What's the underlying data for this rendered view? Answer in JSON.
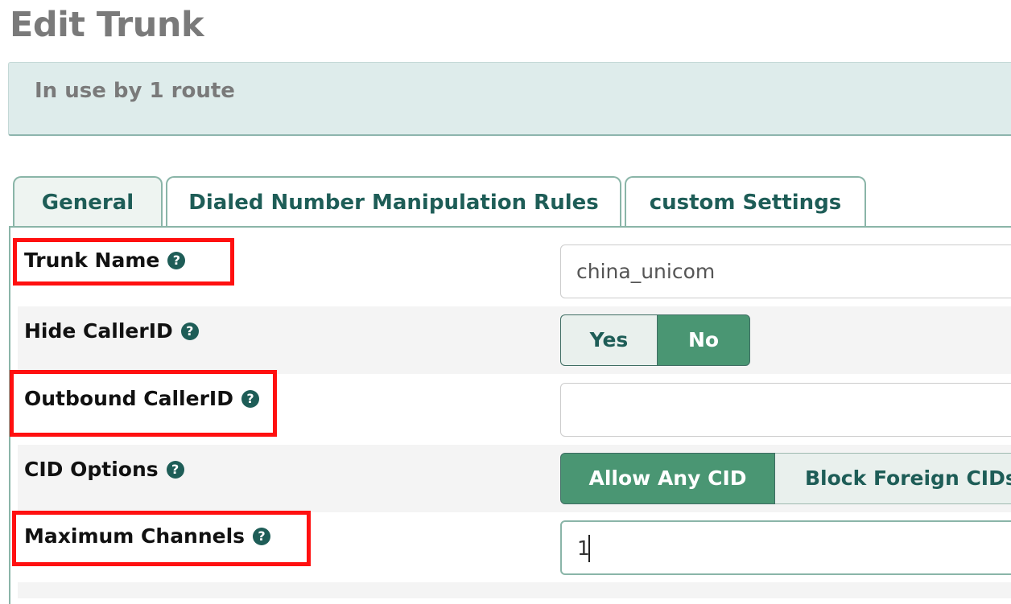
{
  "page": {
    "title": "Edit Trunk"
  },
  "info_panel": {
    "text": "In use by 1 route"
  },
  "tabs": [
    {
      "label": "General",
      "active": true
    },
    {
      "label": "Dialed Number Manipulation Rules",
      "active": false
    },
    {
      "label": "custom Settings",
      "active": false
    }
  ],
  "help_icon_glyph": "?",
  "form": {
    "trunk_name": {
      "label": "Trunk Name",
      "value": "china_unicom"
    },
    "hide_callerid": {
      "label": "Hide CallerID",
      "options": [
        "Yes",
        "No"
      ],
      "selected": "No"
    },
    "outbound_callerid": {
      "label": "Outbound CallerID",
      "value": ""
    },
    "cid_options": {
      "label": "CID Options",
      "options": [
        "Allow Any CID",
        "Block Foreign CIDs"
      ],
      "selected": "Allow Any CID"
    },
    "maximum_channels": {
      "label": "Maximum Channels",
      "value": "1"
    }
  },
  "colors": {
    "accent": "#1e5d57",
    "selected_toggle": "#4a9673",
    "panel_bg": "#deeceb",
    "annotation_box": "#ff1010"
  }
}
